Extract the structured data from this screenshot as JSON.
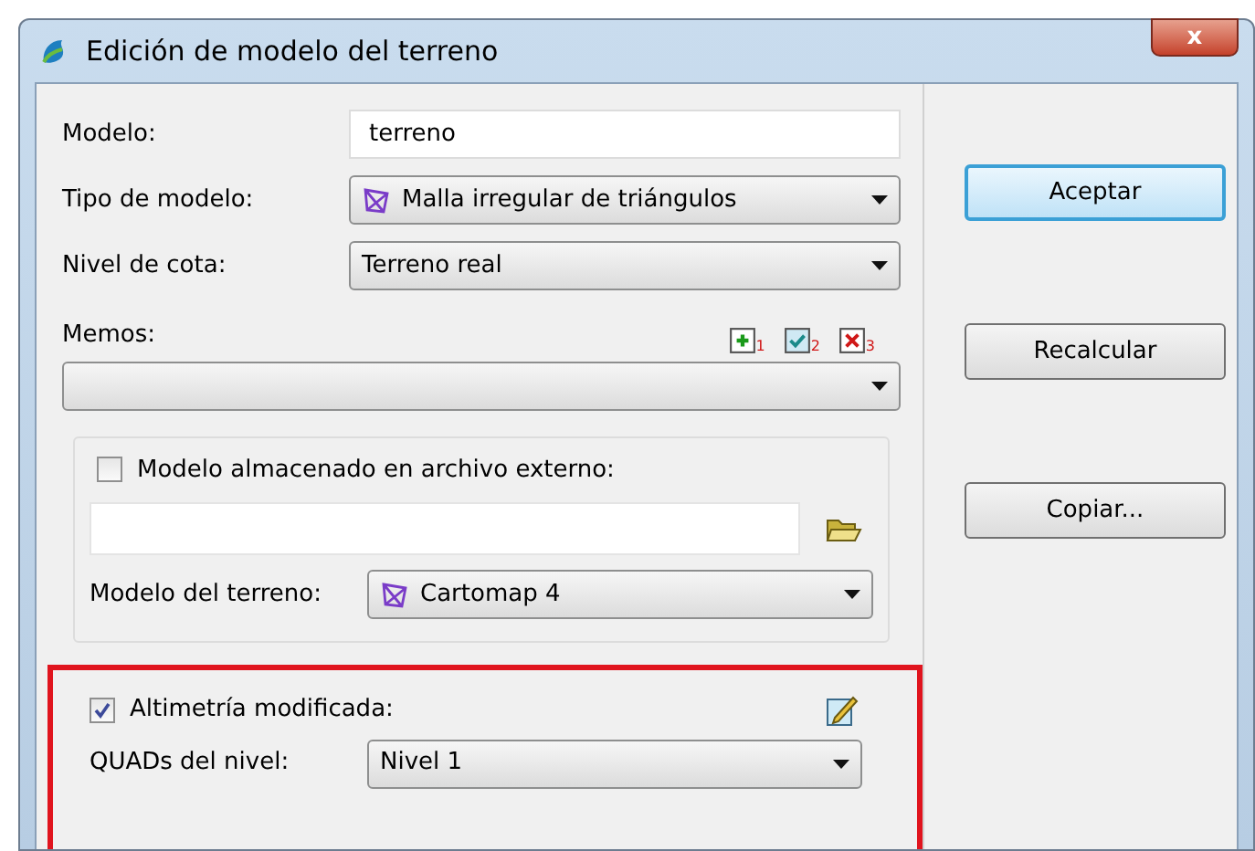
{
  "window": {
    "title": "Edición de modelo del terreno",
    "close": "x"
  },
  "fields": [
    {
      "kind": "input",
      "label": "Modelo:",
      "value": "terreno"
    },
    {
      "kind": "combo",
      "label": "Tipo de modelo:",
      "value": "Malla irregular de triángulos",
      "tin_icon": true
    },
    {
      "kind": "combo",
      "label": "Nivel de cota:",
      "value": "Terreno real",
      "tin_icon": false
    }
  ],
  "memos": {
    "label": "Memos:",
    "icons": [
      {
        "kind": "add",
        "number": "1"
      },
      {
        "kind": "check",
        "number": "2"
      },
      {
        "kind": "delete",
        "number": "3"
      }
    ]
  },
  "external": {
    "label": "Modelo almacenado en archivo externo:",
    "checked": false,
    "terrain_label": "Modelo del terreno:",
    "terrain_value": "Cartomap 4"
  },
  "altimetry": {
    "label": "Altimetría modificada:",
    "checked": true,
    "quads_label": "QUADs del nivel:",
    "quads_value": "Nivel 1",
    "highlighted": true
  },
  "buttons": [
    {
      "label": "Aceptar",
      "default": true
    },
    {
      "label": "Recalcular",
      "default": false
    },
    {
      "label": "Copiar...",
      "default": false
    }
  ]
}
